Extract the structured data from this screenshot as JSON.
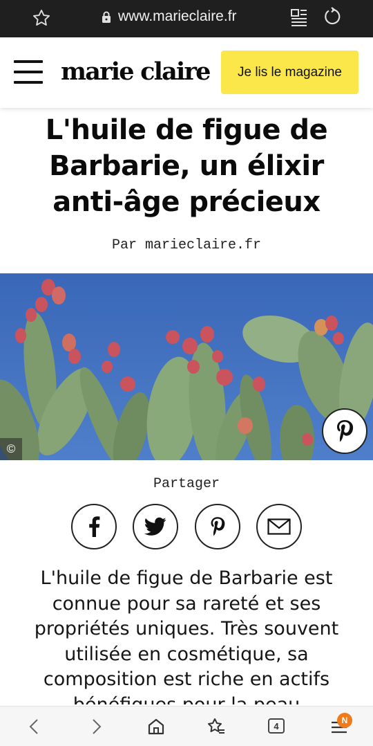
{
  "browser": {
    "url": "www.marieclaire.fr",
    "tab_count": "4",
    "notification_badge": "N"
  },
  "header": {
    "logo": "marie claire",
    "magazine_button": "Je lis le magazine"
  },
  "article": {
    "title": "L'huile de figue de Barbarie, un élixir anti-âge précieux",
    "byline": "Par marieclaire.fr",
    "image_credit_icon": "©",
    "share_label": "Partager",
    "share_buttons": [
      "facebook-icon",
      "twitter-icon",
      "pinterest-icon",
      "email-icon"
    ],
    "body": "L'huile de figue de Barbarie est connue pour sa rareté et ses propriétés uniques. Très souvent utilisée en cosmétique, sa composition est riche en actifs bénéfiques pour la peau"
  },
  "colors": {
    "browser_bar": "#1f1f1f",
    "accent_yellow": "#fbe74a",
    "sky": "#3f6fc0",
    "cactus": "#7f9f6f",
    "fruit": "#c9545e",
    "badge": "#f07b1d"
  }
}
